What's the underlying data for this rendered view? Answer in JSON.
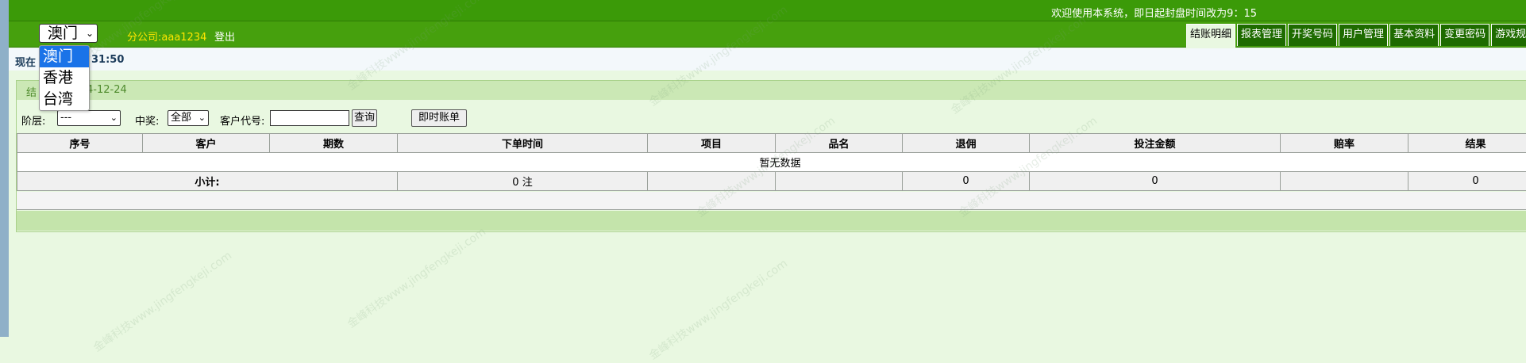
{
  "header": {
    "welcome": "欢迎使用本系统，即日起封盘时间改为9：15",
    "region_selected": "澳门",
    "company": "分公司:aaa1234",
    "logout": "登出"
  },
  "tabs": [
    {
      "label": "结账明细",
      "active": true
    },
    {
      "label": "报表管理",
      "active": false
    },
    {
      "label": "开奖号码",
      "active": false
    },
    {
      "label": "用户管理",
      "active": false
    },
    {
      "label": "基本资料",
      "active": false
    },
    {
      "label": "变更密码",
      "active": false
    },
    {
      "label": "游戏规则",
      "active": false
    }
  ],
  "dropdown": {
    "options": [
      "澳门",
      "香港",
      "台湾"
    ]
  },
  "time_row": {
    "prefix": "现在",
    "time": "31:50"
  },
  "panel": {
    "title": "结",
    "date": "4-12-24"
  },
  "filters": {
    "level_label": "阶层:",
    "level_value": "---",
    "win_label": "中奖:",
    "win_value": "全部",
    "customer_label": "客户代号:",
    "customer_value": "",
    "query_button": "查询",
    "instant_button": "即时账单"
  },
  "table": {
    "columns": [
      "序号",
      "客户",
      "期数",
      "下单时间",
      "项目",
      "品名",
      "退佣",
      "投注金额",
      "赔率",
      "结果"
    ],
    "empty_text": "暂无数据",
    "summary": {
      "label": "小计:",
      "count": "0 注",
      "rebate": "0",
      "amount": "0",
      "result": "0"
    }
  },
  "pager": {
    "select_symbol": "⌄"
  },
  "watermark": "金峰科技www.jingfengkeji.com",
  "colors": {
    "topbar": "#3b9a08",
    "navbar": "#46a00d",
    "tab_bg": "#1e6b00",
    "panel_title": "#cbe8b5",
    "footer_bar": "#c4e4ab",
    "company_text": "#ffe600",
    "selection": "#1a73e8"
  }
}
